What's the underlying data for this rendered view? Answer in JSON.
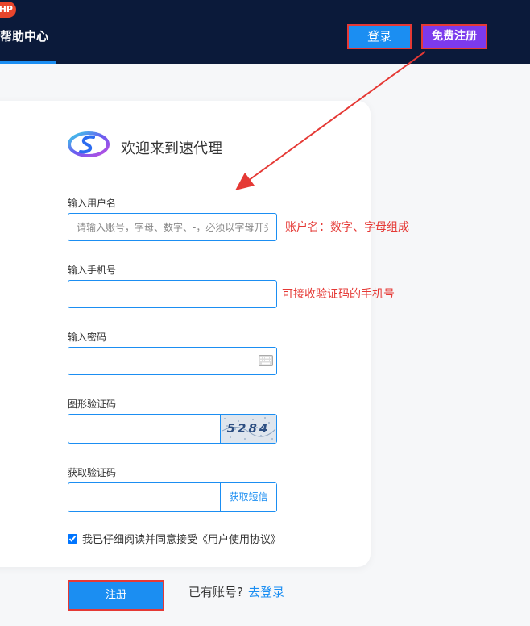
{
  "header": {
    "badge": "HP",
    "help_center": "帮助中心",
    "login_label": "登录",
    "register_label": "免费注册"
  },
  "form": {
    "welcome": "欢迎来到速代理",
    "username": {
      "label": "输入用户名",
      "placeholder": "请输入账号，字母、数字、-，必须以字母开头",
      "annotation": "账户名：数字、字母组成"
    },
    "phone": {
      "label": "输入手机号",
      "placeholder": "",
      "annotation": "可接收验证码的手机号"
    },
    "password": {
      "label": "输入密码",
      "placeholder": ""
    },
    "captcha": {
      "label": "图形验证码",
      "placeholder": "",
      "image_text": "5284"
    },
    "sms": {
      "label": "获取验证码",
      "placeholder": "",
      "button_label": "获取短信"
    },
    "agreement": {
      "text": "我已仔细阅读并同意接受《用户使用协议》",
      "checked": true
    },
    "submit_label": "注册",
    "have_account": "已有账号?",
    "go_login": "去登录"
  },
  "colors": {
    "header_bg": "#0b1a3a",
    "accent": "#1b8ef2",
    "register_purple": "#7c3aed",
    "annotation_red": "#e53935"
  }
}
